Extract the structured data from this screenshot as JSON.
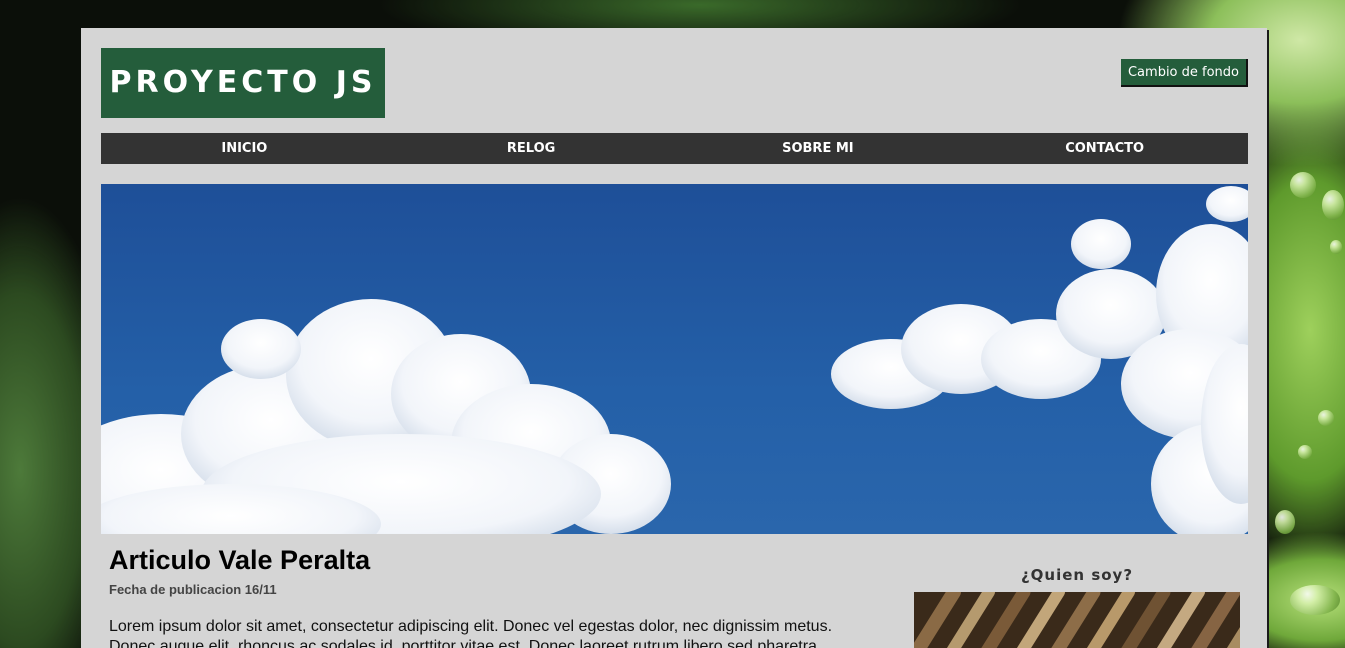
{
  "header": {
    "logo_text": "PROYECTO JS",
    "background_button_label": "Cambio de fondo"
  },
  "nav": {
    "items": [
      {
        "label": "INICIO"
      },
      {
        "label": "RELOG"
      },
      {
        "label": "SOBRE MI"
      },
      {
        "label": "CONTACTO"
      }
    ]
  },
  "article": {
    "title": "Articulo Vale Peralta",
    "date": "Fecha de publicacion 16/11",
    "body": "Lorem ipsum dolor sit amet, consectetur adipiscing elit. Donec vel egestas dolor, nec dignissim metus. Donec augue elit, rhoncus ac sodales id, porttitor vitae est. Donec laoreet rutrum libero sed pharetra."
  },
  "sidebar": {
    "title": "¿Quien soy?"
  },
  "colors": {
    "brand_green": "#245d3b",
    "nav_background": "#333333",
    "page_panel": "#d5d5d5",
    "sky_blue": "#2460a8"
  }
}
